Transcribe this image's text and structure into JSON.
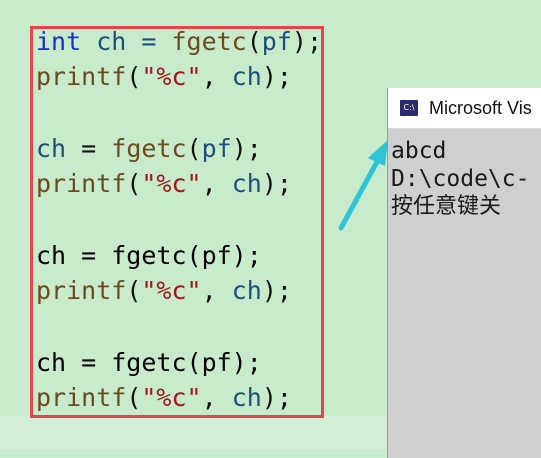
{
  "code": {
    "lines": [
      {
        "t1": "int",
        "t2": " ch = ",
        "t3": "fgetc",
        "t4": "(",
        "t5": "pf",
        "t6": ");"
      },
      {
        "t1": "printf",
        "t2": "(",
        "t3": "\"%c\"",
        "t4": ", ",
        "t5": "ch",
        "t6": ");"
      },
      {
        "t1": "ch",
        "t2": " = ",
        "t3": "fgetc",
        "t4": "(",
        "t5": "pf",
        "t6": ");"
      },
      {
        "t1": "printf",
        "t2": "(",
        "t3": "\"%c\"",
        "t4": ", ",
        "t5": "ch",
        "t6": ");"
      },
      {
        "t1": "ch = fgetc(pf);"
      },
      {
        "t1": "printf",
        "t2": "(",
        "t3": "\"%c\"",
        "t4": ", ",
        "t5": "ch",
        "t6": ");"
      },
      {
        "t1": "ch = fgetc(pf);"
      },
      {
        "t1": "printf",
        "t2": "(",
        "t3": "\"%c\"",
        "t4": ", ",
        "t5": "ch",
        "t6": ");"
      }
    ]
  },
  "console": {
    "icon_label": "C:\\",
    "title": "Microsoft Vis",
    "lines": [
      "abcd",
      "D:\\code\\c-",
      "按任意键关"
    ]
  },
  "colors": {
    "background": "#c7ebcb",
    "highlight_border": "#e8434a",
    "arrow": "#2ec4d6",
    "keyword": "#1a2fd6"
  }
}
